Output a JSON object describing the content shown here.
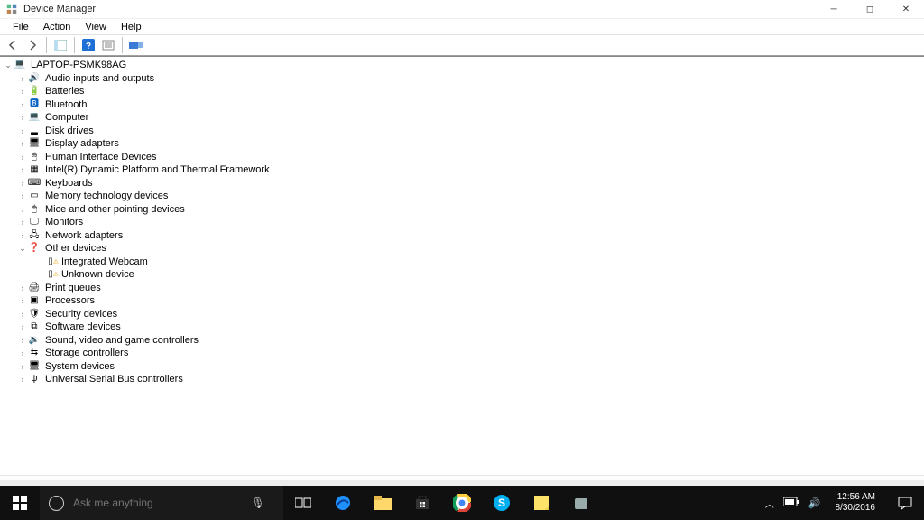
{
  "title": "Device Manager",
  "menubar": {
    "file": "File",
    "action": "Action",
    "view": "View",
    "help": "Help"
  },
  "toolbar": {
    "back": "back",
    "forward": "forward",
    "show": "show-hide-console-tree",
    "help": "help",
    "properties": "properties",
    "scan": "scan-for-hardware-changes"
  },
  "root": {
    "label": "LAPTOP-PSMK98AG",
    "expanded": true
  },
  "categories": [
    {
      "label": "Audio inputs and outputs",
      "icon": "speaker-icon",
      "glyph": "🔊",
      "expanded": false
    },
    {
      "label": "Batteries",
      "icon": "battery-icon",
      "glyph": "🔋",
      "expanded": false
    },
    {
      "label": "Bluetooth",
      "icon": "bluetooth-icon",
      "glyph": "🅱",
      "expanded": false,
      "color": "#0a63c4"
    },
    {
      "label": "Computer",
      "icon": "computer-icon",
      "glyph": "💻",
      "expanded": false
    },
    {
      "label": "Disk drives",
      "icon": "disk-icon",
      "glyph": "▂",
      "expanded": false
    },
    {
      "label": "Display adapters",
      "icon": "display-icon",
      "glyph": "🖥",
      "expanded": false
    },
    {
      "label": "Human Interface Devices",
      "icon": "hid-icon",
      "glyph": "🖱",
      "expanded": false
    },
    {
      "label": "Intel(R) Dynamic Platform and Thermal Framework",
      "icon": "chip-icon",
      "glyph": "▦",
      "expanded": false
    },
    {
      "label": "Keyboards",
      "icon": "keyboard-icon",
      "glyph": "⌨",
      "expanded": false
    },
    {
      "label": "Memory technology devices",
      "icon": "memory-icon",
      "glyph": "▭",
      "expanded": false
    },
    {
      "label": "Mice and other pointing devices",
      "icon": "mouse-icon",
      "glyph": "🖱",
      "expanded": false
    },
    {
      "label": "Monitors",
      "icon": "monitor-icon",
      "glyph": "🖵",
      "expanded": false
    },
    {
      "label": "Network adapters",
      "icon": "network-icon",
      "glyph": "🖧",
      "expanded": false
    },
    {
      "label": "Other devices",
      "icon": "other-icon",
      "glyph": "❓",
      "expanded": true,
      "children": [
        {
          "label": "Integrated Webcam",
          "icon": "unknown-device-icon",
          "glyph": "▯",
          "warn": true
        },
        {
          "label": "Unknown device",
          "icon": "unknown-device-icon",
          "glyph": "▯",
          "warn": true
        }
      ]
    },
    {
      "label": "Print queues",
      "icon": "printer-icon",
      "glyph": "🖨",
      "expanded": false
    },
    {
      "label": "Processors",
      "icon": "cpu-icon",
      "glyph": "▣",
      "expanded": false
    },
    {
      "label": "Security devices",
      "icon": "security-icon",
      "glyph": "🛡",
      "expanded": false
    },
    {
      "label": "Software devices",
      "icon": "software-icon",
      "glyph": "⧉",
      "expanded": false
    },
    {
      "label": "Sound, video and game controllers",
      "icon": "sound-icon",
      "glyph": "🔉",
      "expanded": false
    },
    {
      "label": "Storage controllers",
      "icon": "storage-icon",
      "glyph": "⇆",
      "expanded": false
    },
    {
      "label": "System devices",
      "icon": "system-icon",
      "glyph": "🖥",
      "expanded": false
    },
    {
      "label": "Universal Serial Bus controllers",
      "icon": "usb-icon",
      "glyph": "ψ",
      "expanded": false
    }
  ],
  "cortana": {
    "placeholder": "Ask me anything"
  },
  "tray": {
    "time": "12:56 AM",
    "date": "8/30/2016"
  }
}
